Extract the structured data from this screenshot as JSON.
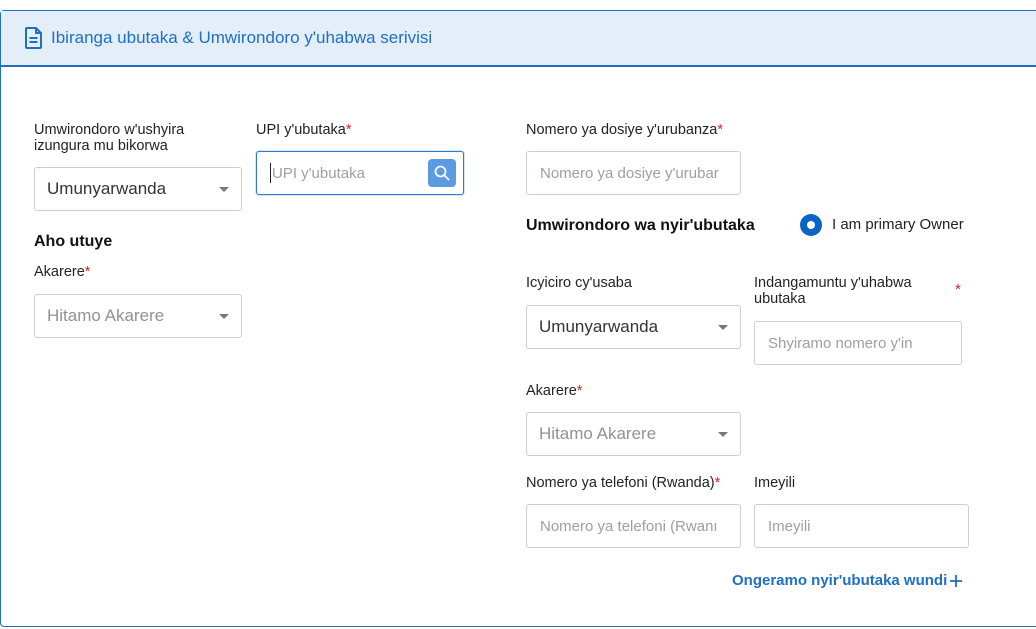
{
  "header": {
    "title": "Ibiranga ubutaka & Umwirondoro y'uhabwa serivisi"
  },
  "left": {
    "nationality_label": "Umwirondoro w'ushyira izungura mu bikorwa",
    "nationality_value": "Umunyarwanda",
    "upi_label": "UPI y'ubutaka",
    "upi_placeholder": "UPI y'ubutaka",
    "residence_title": "Aho utuye",
    "district_label": "Akarere",
    "district_placeholder": "Hitamo Akarere"
  },
  "right": {
    "court_file_label": "Nomero ya dosiye y'urubanza",
    "court_file_placeholder": "Nomero ya dosiye y'urubar",
    "owner_title": "Umwirondoro wa nyir'ubutaka",
    "primary_owner_label": "I am primary Owner",
    "id_type_label": "Icyiciro cy'usaba",
    "id_type_value": "Umunyarwanda",
    "national_id_label": "Indangamuntu y'uhabwa ubutaka",
    "national_id_placeholder": "Shyiramo nomero y'in",
    "district_label": "Akarere",
    "district_placeholder": "Hitamo Akarere",
    "phone_label": "Nomero ya telefoni (Rwanda)",
    "phone_placeholder": "Nomero ya telefoni (Rwanı",
    "email_label": "Imeyili",
    "email_placeholder": "Imeyili",
    "add_owner_link": "Ongeramo nyir'ubutaka wundi"
  },
  "required_marker": "*",
  "colors": {
    "accent": "#1f6fc5",
    "header_bg": "#e3eef9",
    "required": "#e02020",
    "radio": "#0b63c6"
  }
}
